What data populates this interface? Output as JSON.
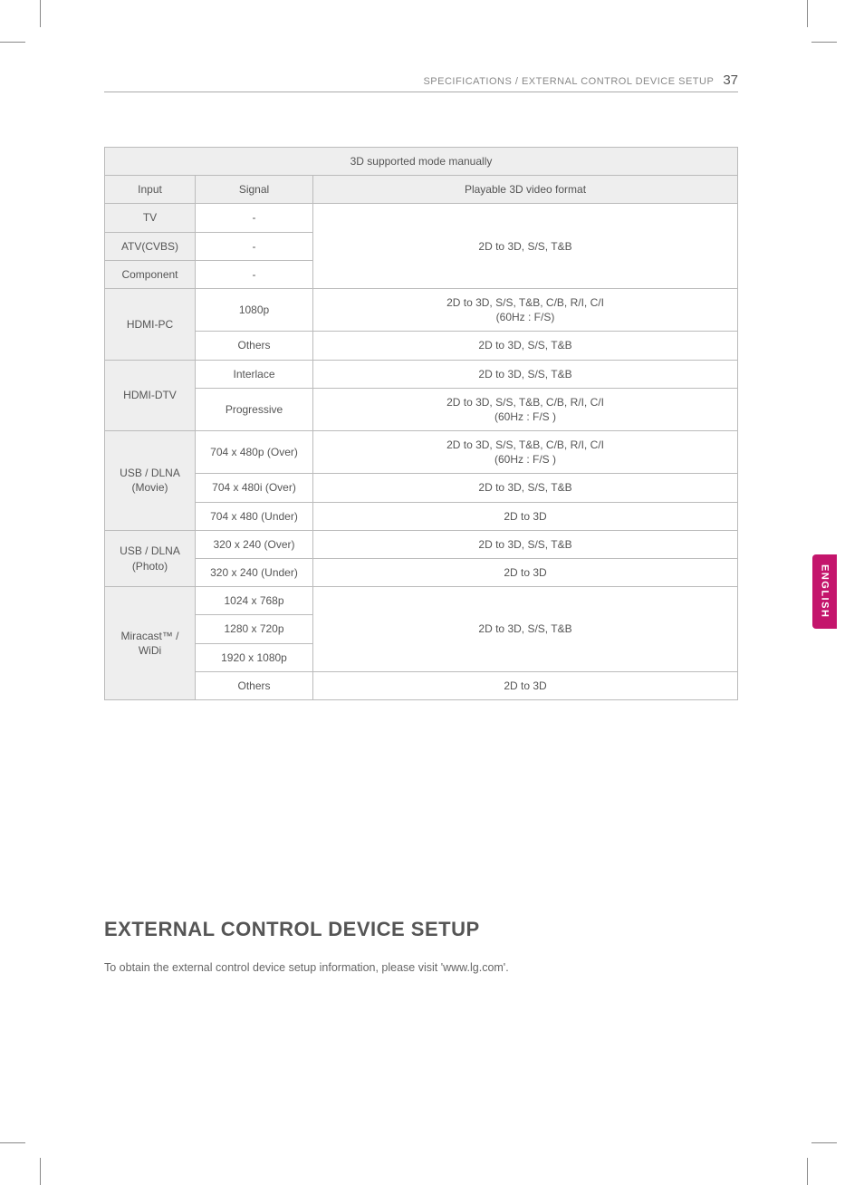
{
  "header": {
    "breadcrumb": "SPECIFICATIONS / EXTERNAL CONTROL DEVICE SETUP",
    "page": "37"
  },
  "table": {
    "title": "3D supported mode manually",
    "cols": {
      "input": "Input",
      "signal": "Signal",
      "format": "Playable 3D video format"
    },
    "r": {
      "tv": {
        "input": "TV",
        "signal": "-"
      },
      "atv": {
        "input": "ATV(CVBS)",
        "signal": "-"
      },
      "comp": {
        "input": "Component",
        "signal": "-"
      },
      "merged_tv": {
        "format": "2D to 3D, S/S, T&B"
      },
      "hdmipc": {
        "input": "HDMI-PC"
      },
      "hdmipc_1": {
        "signal": "1080p",
        "format": "2D to 3D, S/S, T&B, C/B, R/I, C/I\n(60Hz : F/S)"
      },
      "hdmipc_2": {
        "signal": "Others",
        "format": "2D to 3D, S/S, T&B"
      },
      "hdmidtv": {
        "input": "HDMI-DTV"
      },
      "hdmidtv_1": {
        "signal": "Interlace",
        "format": "2D to 3D, S/S, T&B"
      },
      "hdmidtv_2": {
        "signal": "Progressive",
        "format": "2D to 3D, S/S, T&B, C/B, R/I, C/I\n(60Hz : F/S )"
      },
      "usbmov": {
        "input": "USB / DLNA\n(Movie)"
      },
      "usbmov_1": {
        "signal": "704 x 480p (Over)",
        "format": "2D to 3D, S/S, T&B, C/B, R/I, C/I\n(60Hz : F/S )"
      },
      "usbmov_2": {
        "signal": "704 x 480i (Over)",
        "format": "2D to 3D, S/S, T&B"
      },
      "usbmov_3": {
        "signal": "704 x 480 (Under)",
        "format": "2D to 3D"
      },
      "usbpho": {
        "input": "USB / DLNA\n(Photo)"
      },
      "usbpho_1": {
        "signal": "320 x 240 (Over)",
        "format": "2D to 3D, S/S, T&B"
      },
      "usbpho_2": {
        "signal": "320 x 240 (Under)",
        "format": "2D to 3D"
      },
      "mira": {
        "input": "Miracast™ /\nWiDi"
      },
      "mira_1": {
        "signal": "1024 x 768p"
      },
      "mira_2": {
        "signal": "1280 x 720p"
      },
      "mira_3": {
        "signal": "1920 x 1080p"
      },
      "mira_merged": {
        "format": "2D to 3D, S/S, T&B"
      },
      "mira_4": {
        "signal": "Others",
        "format": "2D to 3D"
      }
    }
  },
  "section": {
    "title": "EXTERNAL CONTROL DEVICE SETUP",
    "text": "To obtain the external control device setup information, please visit 'www.lg.com'."
  },
  "lang": "ENGLISH"
}
